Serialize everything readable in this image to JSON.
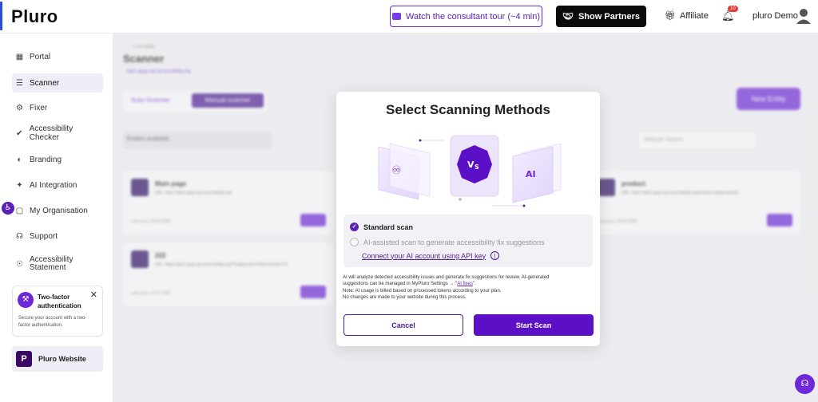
{
  "header": {
    "logo": "Pluro",
    "tour_label": "Watch the consultant tour (~4 min)",
    "partners_label": "Show Partners",
    "affiliate_label": "Affiliate",
    "notification_count": "10",
    "user_name": "pluro Demo"
  },
  "sidebar": {
    "items": [
      {
        "label": "Portal",
        "icon": "grid-icon"
      },
      {
        "label": "Scanner",
        "icon": "scan-icon"
      },
      {
        "label": "Fixer",
        "icon": "gear-icon"
      },
      {
        "label": "Accessibility Checker",
        "icon": "checker-icon"
      },
      {
        "label": "Branding",
        "icon": "palette-icon"
      },
      {
        "label": "AI Integration",
        "icon": "ai-icon"
      },
      {
        "label": "My Organisation",
        "icon": "briefcase-icon"
      },
      {
        "label": "Support",
        "icon": "headset-icon"
      },
      {
        "label": "Accessibility Statement",
        "icon": "accessibility-icon"
      }
    ],
    "twofa": {
      "title": "Two-factor authentication",
      "text": "Secure your account with a two-factor authentication."
    },
    "website_label": "Pluro Website"
  },
  "main": {
    "back": "< Go Back",
    "title": "Scanner",
    "url": "site2.apyp.wp-accessibility.org",
    "tab_auto": "Auto-Scanner",
    "tab_manual": "Manual scanner",
    "new_entity": "New Entity",
    "entities": "Entities available:",
    "search_placeholder": "Website Search",
    "cards": [
      {
        "title": "Main page",
        "url": "URL: https://site2.apyp.wp-accessibility.org/",
        "last": "Last scan: 00.00.0000"
      },
      {
        "title": "222",
        "url": "URL: https://site2.apyp.wp-accessibility.org/?Category/3=22&Archived=170",
        "last": "Last scan: 23.07.2025"
      },
      {
        "title": "product",
        "url": "URL: https://site2.apyp.wp-accessibility.org/product-category/buds",
        "last": "Last scan: 00.00.0000"
      }
    ]
  },
  "modal": {
    "title": "Select Scanning Methods",
    "option_standard": "Standard scan",
    "option_ai": "AI-assisted scan to generate accessibility fix suggestions",
    "api_link": "Connect your AI account using API key",
    "note_line1": "AI will analyze detected accessibility issues and generate fix suggestions for review. AI-generated",
    "note_line2a": "suggestions can be managed in MyPluro Settings → \"",
    "note_link": "AI fixes",
    "note_line2b": "\".",
    "note_line3": "Note: AI usage is billed based on processed tokens according to your plan.",
    "note_line4": "No changes are made to your website during this process.",
    "cancel_label": "Cancel",
    "start_label": "Start Scan"
  },
  "colors": {
    "accent": "#5b0fc6",
    "dark": "#0b0b0b"
  }
}
